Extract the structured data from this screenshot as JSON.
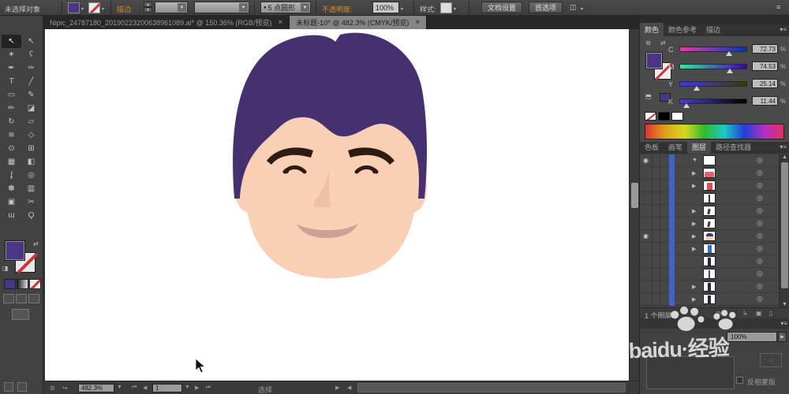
{
  "topbar": {
    "no_selection": "未选择对象",
    "stroke_label": "描边:",
    "brush_bullet": "●",
    "brush_definition": "5 点圆形",
    "opacity_label": "不透明度:",
    "opacity_value": "100%",
    "style_label": "样式:",
    "document_setup": "文档设置",
    "preferences": "首选项"
  },
  "tabs": [
    {
      "title": "Nipic_24787180_20190223200638961089.ai* @ 150.36% (RGB/预览)",
      "close": "×",
      "active": false
    },
    {
      "title": "未标题-10* @ 482.3% (CMYK/预览)",
      "close": "×",
      "active": true
    }
  ],
  "tools": [
    {
      "name": "selection-tool",
      "glyph": "↖",
      "active": true
    },
    {
      "name": "direct-selection-tool",
      "glyph": "↖",
      "active": false
    },
    {
      "name": "magic-wand-tool",
      "glyph": "✶",
      "active": false
    },
    {
      "name": "lasso-tool",
      "glyph": "ʕ",
      "active": false
    },
    {
      "name": "pen-tool",
      "glyph": "✒",
      "active": false
    },
    {
      "name": "curvature-tool",
      "glyph": "✑",
      "active": false
    },
    {
      "name": "type-tool",
      "glyph": "T",
      "active": false
    },
    {
      "name": "line-segment-tool",
      "glyph": "╱",
      "active": false
    },
    {
      "name": "rectangle-tool",
      "glyph": "▭",
      "active": false
    },
    {
      "name": "paintbrush-tool",
      "glyph": "✎",
      "active": false
    },
    {
      "name": "pencil-tool",
      "glyph": "✏",
      "active": false
    },
    {
      "name": "eraser-tool",
      "glyph": "◪",
      "active": false
    },
    {
      "name": "rotate-tool",
      "glyph": "↻",
      "active": false
    },
    {
      "name": "scale-tool",
      "glyph": "▱",
      "active": false
    },
    {
      "name": "width-tool",
      "glyph": "≋",
      "active": false
    },
    {
      "name": "free-transform-tool",
      "glyph": "◇",
      "active": false
    },
    {
      "name": "shape-builder-tool",
      "glyph": "⊙",
      "active": false
    },
    {
      "name": "perspective-grid-tool",
      "glyph": "⊞",
      "active": false
    },
    {
      "name": "mesh-tool",
      "glyph": "▦",
      "active": false
    },
    {
      "name": "gradient-tool",
      "glyph": "◧",
      "active": false
    },
    {
      "name": "eyedropper-tool",
      "glyph": "ʄ",
      "active": false
    },
    {
      "name": "blend-tool",
      "glyph": "◎",
      "active": false
    },
    {
      "name": "symbol-sprayer-tool",
      "glyph": "✽",
      "active": false
    },
    {
      "name": "column-graph-tool",
      "glyph": "▥",
      "active": false
    },
    {
      "name": "artboard-tool",
      "glyph": "▣",
      "active": false
    },
    {
      "name": "slice-tool",
      "glyph": "✂",
      "active": false
    },
    {
      "name": "hand-tool",
      "glyph": "ɯ",
      "active": false
    },
    {
      "name": "zoom-tool",
      "glyph": "Ǫ",
      "active": false
    }
  ],
  "color_panel": {
    "tabs": [
      {
        "label": "颜色",
        "active": true
      },
      {
        "label": "颜色参考",
        "active": false
      },
      {
        "label": "描边",
        "active": false
      }
    ],
    "channels": [
      {
        "label": "C",
        "value": "72.73",
        "unit": "%",
        "percent": 73,
        "grad_from": "#e23aa9",
        "grad_to": "#003aa9"
      },
      {
        "label": "M",
        "value": "74.53",
        "unit": "%",
        "percent": 74,
        "grad_from": "#3ee2a9",
        "grad_to": "#3e00a9"
      },
      {
        "label": "Y",
        "value": "25.14",
        "unit": "%",
        "percent": 25,
        "grad_from": "#3e3ae2",
        "grad_to": "#3e3a00"
      },
      {
        "label": "K",
        "value": "11.44",
        "unit": "%",
        "percent": 11,
        "grad_from": "#4641bf",
        "grad_to": "#000000"
      }
    ]
  },
  "dock_tabs": [
    {
      "label": "色板",
      "active": false
    },
    {
      "label": "画笔",
      "active": false
    },
    {
      "label": "图层",
      "active": true
    },
    {
      "label": "路径查找器",
      "active": false
    }
  ],
  "layers": {
    "rows": [
      {
        "eye": true,
        "triangle": "down",
        "thumb": "blank"
      },
      {
        "eye": false,
        "triangle": "right",
        "thumb": "red-wide"
      },
      {
        "eye": false,
        "triangle": "right",
        "thumb": "red-small"
      },
      {
        "eye": false,
        "triangle": "none",
        "thumb": "line-dark"
      },
      {
        "eye": false,
        "triangle": "right",
        "thumb": "mark-left"
      },
      {
        "eye": false,
        "triangle": "right",
        "thumb": "mark-left"
      },
      {
        "eye": true,
        "triangle": "right",
        "thumb": "face"
      },
      {
        "eye": false,
        "triangle": "right",
        "thumb": "bar-blue"
      },
      {
        "eye": false,
        "triangle": "none",
        "thumb": "bar-navy"
      },
      {
        "eye": false,
        "triangle": "none",
        "thumb": "line-purple"
      },
      {
        "eye": false,
        "triangle": "right",
        "thumb": "bar-dark"
      },
      {
        "eye": false,
        "triangle": "right",
        "thumb": "bar-dark"
      }
    ],
    "footer_count": "1 个图层"
  },
  "transparency": {
    "opacity_value": "100%",
    "invert_mask": "反相蒙版"
  },
  "statusbar": {
    "zoom": "482.3%",
    "artboard": "1",
    "tool": "选择"
  },
  "watermark": "baidu·经验",
  "colors": {
    "accent_fill": "#4b3585",
    "hair": "#453170",
    "skin": "#f9cfb5",
    "nose": "#eec0a6",
    "features": "#2e1b13",
    "mouth": "#cfa096",
    "layer_stripe": "#3f63c9"
  }
}
